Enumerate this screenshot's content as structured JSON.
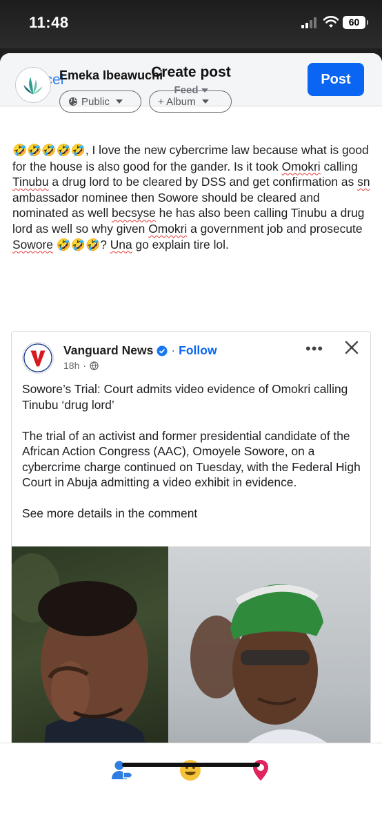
{
  "status_bar": {
    "time": "11:48",
    "battery": "60"
  },
  "header": {
    "cancel_label": "Cancel",
    "title": "Create post",
    "audience_label": "Feed",
    "post_label": "Post"
  },
  "author": {
    "name": "Emeka Ibeawuchi",
    "privacy_label": "Public",
    "album_label": "+ Album"
  },
  "post": {
    "emojis_lead": "🤣🤣🤣🤣🤣",
    "t1": ", I love the new cybercrime law because what is good for the house is also good for the gander. Is it took ",
    "w_omokri1": "Omokri",
    "t2": " calling ",
    "w_tinubu": "Tinubu",
    "t3": " a drug lord to be cleared by DSS and get confirmation as ",
    "w_sn": "sn",
    "t4": " ambassador nominee then Sowore should be cleared and nominated as well ",
    "w_becsyse": "becsyse",
    "t5": " he has also been calling Tinubu a drug lord as well so why given ",
    "w_omokri2": "Omokri",
    "t6": " a government job and prosecute ",
    "w_sowore": "Sowore",
    "emojis_tail": " 🤣🤣🤣",
    "t7": "? ",
    "w_una": "Una",
    "t8": " go explain tire lol."
  },
  "shared": {
    "page_name": "Vanguard News",
    "separator": "·",
    "follow_label": "Follow",
    "time": "18h",
    "meta_dot": "·",
    "more": "•••",
    "headline": "Sowore’s Trial: Court admits video evidence of Omokri calling Tinubu ‘drug lord’",
    "paragraph": "The trial of an activist and former presidential candidate of the African Action Congress (AAC), Omoyele Sowore, on a cybercrime charge continued on Tuesday, with the Federal High Court in Abuja admitting a video exhibit in evidence.",
    "see_more": "See more details in the comment"
  },
  "colors": {
    "accent": "#0a66f2",
    "tag_blue": "#2f7de1",
    "feeling_yellow": "#f5c33b",
    "location_red": "#e0245e"
  }
}
